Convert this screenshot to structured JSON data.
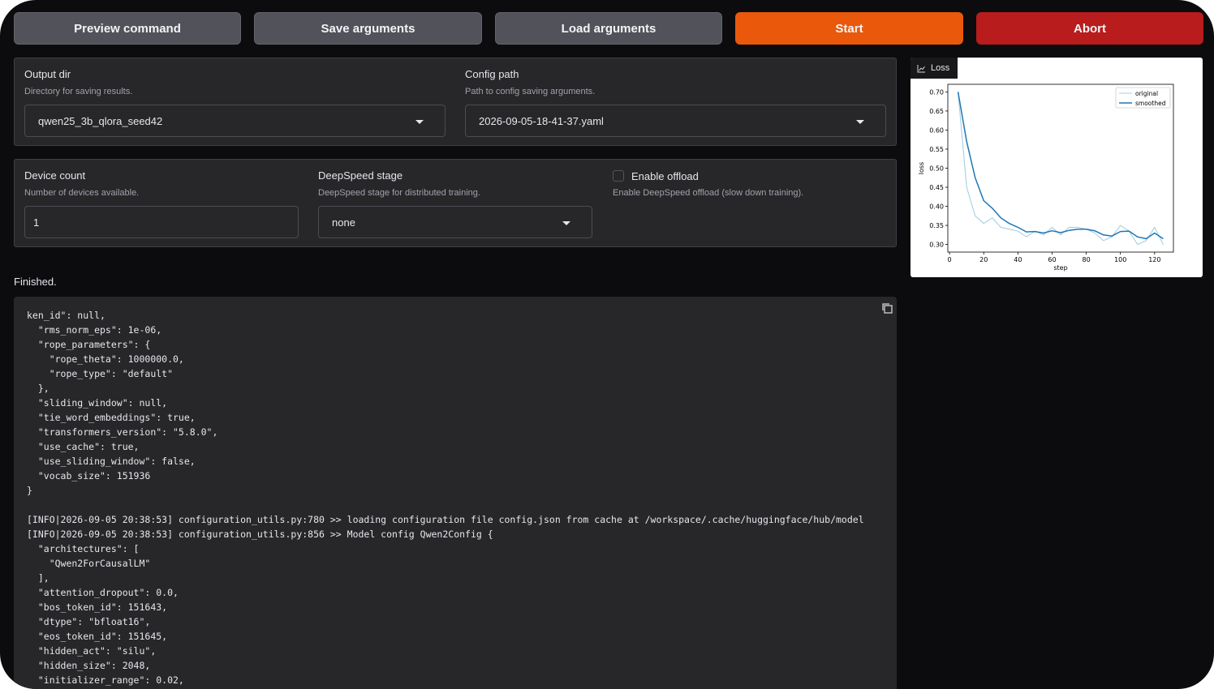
{
  "toolbar": {
    "preview_label": "Preview command",
    "save_label": "Save arguments",
    "load_label": "Load arguments",
    "start_label": "Start",
    "abort_label": "Abort"
  },
  "colors": {
    "start": "#ea580c",
    "abort": "#b91c1c",
    "panel": "#27272a",
    "background": "#0c0c0f",
    "series_original": "#a6cee3",
    "series_smoothed": "#1f77b4"
  },
  "output_dir": {
    "label": "Output dir",
    "info": "Directory for saving results.",
    "value": "qwen25_3b_qlora_seed42"
  },
  "config_path": {
    "label": "Config path",
    "info": "Path to config saving arguments.",
    "value": "2026-09-05-18-41-37.yaml"
  },
  "device_count": {
    "label": "Device count",
    "info": "Number of devices available.",
    "value": "1"
  },
  "deepspeed": {
    "label": "DeepSpeed stage",
    "info": "DeepSpeed stage for distributed training.",
    "value": "none"
  },
  "offload": {
    "label": "Enable offload",
    "info": "Enable DeepSpeed offload (slow down training).",
    "checked": false
  },
  "status": {
    "text": "Finished."
  },
  "log": {
    "text": "ken_id\": null,\n  \"rms_norm_eps\": 1e-06,\n  \"rope_parameters\": {\n    \"rope_theta\": 1000000.0,\n    \"rope_type\": \"default\"\n  },\n  \"sliding_window\": null,\n  \"tie_word_embeddings\": true,\n  \"transformers_version\": \"5.8.0\",\n  \"use_cache\": true,\n  \"use_sliding_window\": false,\n  \"vocab_size\": 151936\n}\n\n[INFO|2026-09-05 20:38:53] configuration_utils.py:780 >> loading configuration file config.json from cache at /workspace/.cache/huggingface/hub/model\n[INFO|2026-09-05 20:38:53] configuration_utils.py:856 >> Model config Qwen2Config {\n  \"architectures\": [\n    \"Qwen2ForCausalLM\"\n  ],\n  \"attention_dropout\": 0.0,\n  \"bos_token_id\": 151643,\n  \"dtype\": \"bfloat16\",\n  \"eos_token_id\": 151645,\n  \"hidden_act\": \"silu\",\n  \"hidden_size\": 2048,\n  \"initializer_range\": 0.02,"
  },
  "chart_tab": {
    "label": "Loss",
    "icon": "chart-icon"
  },
  "chart_data": {
    "type": "line",
    "xlabel": "step",
    "ylabel": "loss",
    "xlim": [
      -1,
      131
    ],
    "ylim": [
      0.28,
      0.72
    ],
    "xticks": [
      0,
      20,
      40,
      60,
      80,
      100,
      120
    ],
    "yticks": [
      0.3,
      0.35,
      0.4,
      0.45,
      0.5,
      0.55,
      0.6,
      0.65,
      0.7
    ],
    "legend_position": "top-right",
    "grid": false,
    "series": [
      {
        "name": "original",
        "x": [
          5,
          10,
          15,
          20,
          25,
          30,
          35,
          40,
          45,
          50,
          55,
          60,
          65,
          70,
          75,
          80,
          85,
          90,
          95,
          100,
          105,
          110,
          115,
          120,
          125
        ],
        "values": [
          0.7,
          0.45,
          0.375,
          0.355,
          0.37,
          0.345,
          0.34,
          0.335,
          0.32,
          0.335,
          0.325,
          0.345,
          0.325,
          0.345,
          0.345,
          0.34,
          0.33,
          0.31,
          0.32,
          0.35,
          0.335,
          0.3,
          0.31,
          0.345,
          0.3
        ]
      },
      {
        "name": "smoothed",
        "x": [
          5,
          10,
          15,
          20,
          25,
          30,
          35,
          40,
          45,
          50,
          55,
          60,
          65,
          70,
          75,
          80,
          85,
          90,
          95,
          100,
          105,
          110,
          115,
          120,
          125
        ],
        "values": [
          0.7,
          0.57,
          0.475,
          0.415,
          0.395,
          0.37,
          0.355,
          0.345,
          0.333,
          0.334,
          0.33,
          0.336,
          0.331,
          0.337,
          0.34,
          0.34,
          0.336,
          0.325,
          0.322,
          0.334,
          0.335,
          0.32,
          0.315,
          0.33,
          0.315
        ]
      }
    ]
  }
}
